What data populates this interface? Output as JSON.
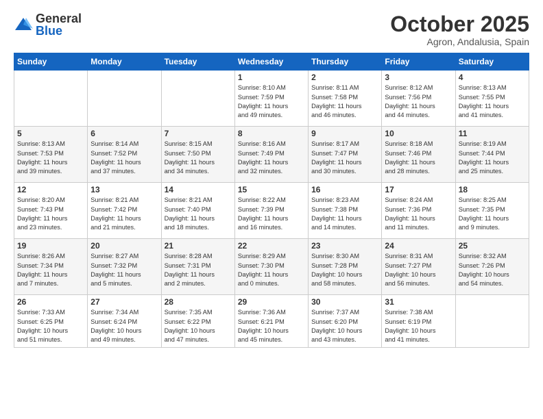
{
  "logo": {
    "general": "General",
    "blue": "Blue"
  },
  "header": {
    "month": "October 2025",
    "location": "Agron, Andalusia, Spain"
  },
  "weekdays": [
    "Sunday",
    "Monday",
    "Tuesday",
    "Wednesday",
    "Thursday",
    "Friday",
    "Saturday"
  ],
  "weeks": [
    [
      {
        "day": "",
        "info": ""
      },
      {
        "day": "",
        "info": ""
      },
      {
        "day": "",
        "info": ""
      },
      {
        "day": "1",
        "info": "Sunrise: 8:10 AM\nSunset: 7:59 PM\nDaylight: 11 hours\nand 49 minutes."
      },
      {
        "day": "2",
        "info": "Sunrise: 8:11 AM\nSunset: 7:58 PM\nDaylight: 11 hours\nand 46 minutes."
      },
      {
        "day": "3",
        "info": "Sunrise: 8:12 AM\nSunset: 7:56 PM\nDaylight: 11 hours\nand 44 minutes."
      },
      {
        "day": "4",
        "info": "Sunrise: 8:13 AM\nSunset: 7:55 PM\nDaylight: 11 hours\nand 41 minutes."
      }
    ],
    [
      {
        "day": "5",
        "info": "Sunrise: 8:13 AM\nSunset: 7:53 PM\nDaylight: 11 hours\nand 39 minutes."
      },
      {
        "day": "6",
        "info": "Sunrise: 8:14 AM\nSunset: 7:52 PM\nDaylight: 11 hours\nand 37 minutes."
      },
      {
        "day": "7",
        "info": "Sunrise: 8:15 AM\nSunset: 7:50 PM\nDaylight: 11 hours\nand 34 minutes."
      },
      {
        "day": "8",
        "info": "Sunrise: 8:16 AM\nSunset: 7:49 PM\nDaylight: 11 hours\nand 32 minutes."
      },
      {
        "day": "9",
        "info": "Sunrise: 8:17 AM\nSunset: 7:47 PM\nDaylight: 11 hours\nand 30 minutes."
      },
      {
        "day": "10",
        "info": "Sunrise: 8:18 AM\nSunset: 7:46 PM\nDaylight: 11 hours\nand 28 minutes."
      },
      {
        "day": "11",
        "info": "Sunrise: 8:19 AM\nSunset: 7:44 PM\nDaylight: 11 hours\nand 25 minutes."
      }
    ],
    [
      {
        "day": "12",
        "info": "Sunrise: 8:20 AM\nSunset: 7:43 PM\nDaylight: 11 hours\nand 23 minutes."
      },
      {
        "day": "13",
        "info": "Sunrise: 8:21 AM\nSunset: 7:42 PM\nDaylight: 11 hours\nand 21 minutes."
      },
      {
        "day": "14",
        "info": "Sunrise: 8:21 AM\nSunset: 7:40 PM\nDaylight: 11 hours\nand 18 minutes."
      },
      {
        "day": "15",
        "info": "Sunrise: 8:22 AM\nSunset: 7:39 PM\nDaylight: 11 hours\nand 16 minutes."
      },
      {
        "day": "16",
        "info": "Sunrise: 8:23 AM\nSunset: 7:38 PM\nDaylight: 11 hours\nand 14 minutes."
      },
      {
        "day": "17",
        "info": "Sunrise: 8:24 AM\nSunset: 7:36 PM\nDaylight: 11 hours\nand 11 minutes."
      },
      {
        "day": "18",
        "info": "Sunrise: 8:25 AM\nSunset: 7:35 PM\nDaylight: 11 hours\nand 9 minutes."
      }
    ],
    [
      {
        "day": "19",
        "info": "Sunrise: 8:26 AM\nSunset: 7:34 PM\nDaylight: 11 hours\nand 7 minutes."
      },
      {
        "day": "20",
        "info": "Sunrise: 8:27 AM\nSunset: 7:32 PM\nDaylight: 11 hours\nand 5 minutes."
      },
      {
        "day": "21",
        "info": "Sunrise: 8:28 AM\nSunset: 7:31 PM\nDaylight: 11 hours\nand 2 minutes."
      },
      {
        "day": "22",
        "info": "Sunrise: 8:29 AM\nSunset: 7:30 PM\nDaylight: 11 hours\nand 0 minutes."
      },
      {
        "day": "23",
        "info": "Sunrise: 8:30 AM\nSunset: 7:28 PM\nDaylight: 10 hours\nand 58 minutes."
      },
      {
        "day": "24",
        "info": "Sunrise: 8:31 AM\nSunset: 7:27 PM\nDaylight: 10 hours\nand 56 minutes."
      },
      {
        "day": "25",
        "info": "Sunrise: 8:32 AM\nSunset: 7:26 PM\nDaylight: 10 hours\nand 54 minutes."
      }
    ],
    [
      {
        "day": "26",
        "info": "Sunrise: 7:33 AM\nSunset: 6:25 PM\nDaylight: 10 hours\nand 51 minutes."
      },
      {
        "day": "27",
        "info": "Sunrise: 7:34 AM\nSunset: 6:24 PM\nDaylight: 10 hours\nand 49 minutes."
      },
      {
        "day": "28",
        "info": "Sunrise: 7:35 AM\nSunset: 6:22 PM\nDaylight: 10 hours\nand 47 minutes."
      },
      {
        "day": "29",
        "info": "Sunrise: 7:36 AM\nSunset: 6:21 PM\nDaylight: 10 hours\nand 45 minutes."
      },
      {
        "day": "30",
        "info": "Sunrise: 7:37 AM\nSunset: 6:20 PM\nDaylight: 10 hours\nand 43 minutes."
      },
      {
        "day": "31",
        "info": "Sunrise: 7:38 AM\nSunset: 6:19 PM\nDaylight: 10 hours\nand 41 minutes."
      },
      {
        "day": "",
        "info": ""
      }
    ]
  ]
}
